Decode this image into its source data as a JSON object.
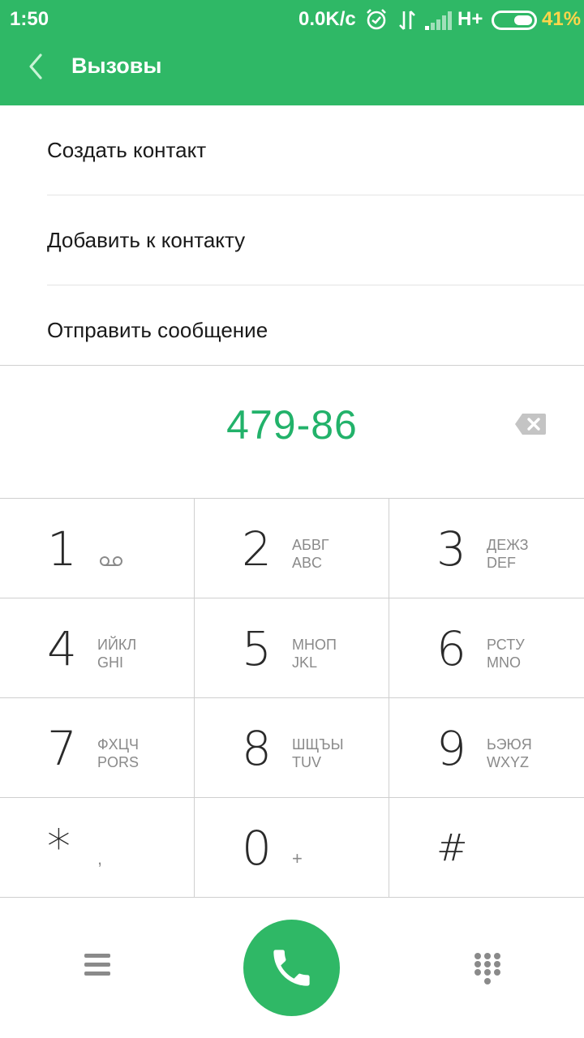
{
  "status_bar": {
    "time": "1:50",
    "speed": "0.0K/c",
    "network": "H+",
    "battery_percent": "41%",
    "battery_level": 0.41,
    "icons": [
      "alarm-icon",
      "data-arrows-icon",
      "signal-icon",
      "battery-icon"
    ]
  },
  "app_bar": {
    "title": "Вызовы",
    "back_icon": "chevron-left-icon"
  },
  "menu": {
    "items": [
      {
        "label": "Создать контакт"
      },
      {
        "label": "Добавить к контакту"
      },
      {
        "label": "Отправить сообщение"
      }
    ]
  },
  "dialer": {
    "number": "479-86",
    "backspace_icon": "backspace-icon"
  },
  "keypad": {
    "keys": [
      {
        "digit": "1",
        "line1": "",
        "line2": "",
        "icon": "voicemail-icon"
      },
      {
        "digit": "2",
        "line1": "АБВГ",
        "line2": "ABC"
      },
      {
        "digit": "3",
        "line1": "ДЕЖЗ",
        "line2": "DEF"
      },
      {
        "digit": "4",
        "line1": "ИЙКЛ",
        "line2": "GHI"
      },
      {
        "digit": "5",
        "line1": "МНОП",
        "line2": "JKL"
      },
      {
        "digit": "6",
        "line1": "РСТУ",
        "line2": "MNO"
      },
      {
        "digit": "7",
        "line1": "ФХЦЧ",
        "line2": "PORS"
      },
      {
        "digit": "8",
        "line1": "ШЩЪЫ",
        "line2": "TUV"
      },
      {
        "digit": "9",
        "line1": "ЬЭЮЯ",
        "line2": "WXYZ"
      },
      {
        "digit": "*",
        "sym": ","
      },
      {
        "digit": "0",
        "sym": "+"
      },
      {
        "digit": "#",
        "sym": ""
      }
    ]
  },
  "actions": {
    "menu_icon": "hamburger-menu-icon",
    "call_icon": "phone-icon",
    "dialpad_icon": "dialpad-icon"
  },
  "colors": {
    "accent": "#2fb866",
    "number_text": "#22b26a",
    "battery_text": "#ffd54a"
  }
}
